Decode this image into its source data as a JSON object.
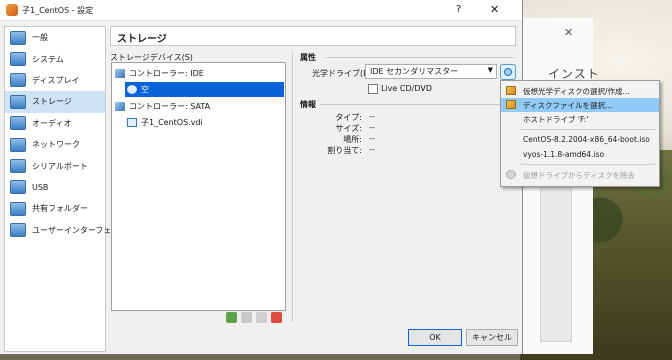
{
  "window": {
    "title": "子1_CentOS - 設定",
    "help_label": "?",
    "close_label": "✕"
  },
  "background_window": {
    "close_label": "✕",
    "title_fragment": "インスト"
  },
  "sidebar": {
    "items": [
      {
        "label": "一般",
        "icon": "general-icon"
      },
      {
        "label": "システム",
        "icon": "system-icon"
      },
      {
        "label": "ディスプレイ",
        "icon": "display-icon"
      },
      {
        "label": "ストレージ",
        "icon": "storage-icon",
        "active": true
      },
      {
        "label": "オーディオ",
        "icon": "audio-icon"
      },
      {
        "label": "ネットワーク",
        "icon": "network-icon"
      },
      {
        "label": "シリアルポート",
        "icon": "serial-port-icon"
      },
      {
        "label": "USB",
        "icon": "usb-icon"
      },
      {
        "label": "共有フォルダー",
        "icon": "shared-folder-icon"
      },
      {
        "label": "ユーザーインターフェース",
        "icon": "user-interface-icon"
      }
    ]
  },
  "page": {
    "title": "ストレージ"
  },
  "storage_devices": {
    "label": "ストレージデバイス(S)",
    "tree": [
      {
        "label": "コントローラー: IDE",
        "level": 0,
        "icon": "ide-controller-icon"
      },
      {
        "label": "空",
        "level": 1,
        "icon": "optical-disc-icon",
        "selected": true
      },
      {
        "label": "コントローラー: SATA",
        "level": 0,
        "icon": "sata-controller-icon"
      },
      {
        "label": "子1_CentOS.vdi",
        "level": 1,
        "icon": "hard-disk-icon"
      }
    ]
  },
  "attributes": {
    "heading": "属性",
    "optical_drive_label": "光学ドライブ(D):",
    "optical_drive_value": "IDE セカンダリマスター",
    "live_cd_label": "Live CD/DVD"
  },
  "information": {
    "heading": "情報",
    "rows": [
      {
        "key": "タイプ:",
        "value": "--"
      },
      {
        "key": "サイズ:",
        "value": "--"
      },
      {
        "key": "場所:",
        "value": "--"
      },
      {
        "key": "割り当て:",
        "value": "--"
      }
    ]
  },
  "buttons": {
    "ok": "OK",
    "cancel": "キャンセル"
  },
  "context_menu": {
    "items": [
      {
        "label": "仮想光学ディスクの選択/作成...",
        "icon": "create-disk-icon"
      },
      {
        "label": "ディスクファイルを選択...",
        "icon": "choose-file-icon",
        "highlighted": true
      },
      {
        "label": "ホストドライブ 'F:'",
        "icon": ""
      },
      {
        "label": "CentOS-8.2.2004-x86_64-boot.iso",
        "icon": ""
      },
      {
        "label": "vyos-1.1.8-amd64.iso",
        "icon": ""
      },
      {
        "label": "仮想ドライブからディスクを除去",
        "icon": "remove-disk-icon",
        "disabled": true
      }
    ]
  },
  "colors": {
    "selection": "#0a64d8",
    "sidebar_active": "#cfe3f7",
    "menu_highlight": "#91c9f7"
  }
}
